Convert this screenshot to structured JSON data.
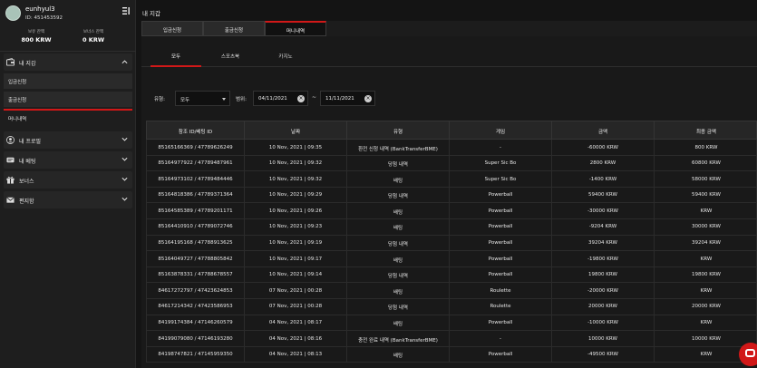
{
  "user": {
    "name": "eunhyul3",
    "id_label": "ID: 451453592"
  },
  "balances": {
    "held_label": "보유 잔액",
    "held_value": "800 KRW",
    "bonus_label": "보너스 잔액",
    "bonus_value": "0 KRW"
  },
  "sidebar": {
    "wallet": "내 지갑",
    "deposit": "입금신청",
    "withdraw": "출금신청",
    "history": "머니내역",
    "profile": "내 프로필",
    "betting": "내 베팅",
    "bonus": "보너스",
    "messages": "편지함"
  },
  "page": {
    "title": "내 지갑"
  },
  "top_tabs": {
    "deposit": "입금신청",
    "withdraw": "출금신청",
    "history": "머니내역"
  },
  "sub_tabs": {
    "all": "모두",
    "sports": "스포츠북",
    "casino": "카지노"
  },
  "filters": {
    "type_label": "유형:",
    "type_value": "모두",
    "range_label": "범위:",
    "date_from": "04/11/2021",
    "date_to": "11/11/2021",
    "separator": "~"
  },
  "table": {
    "headers": [
      "참조 ID/베팅 ID",
      "날짜",
      "유형",
      "게임",
      "금액",
      "최종 금액"
    ],
    "rows": [
      [
        "85165166369 / 47789626249",
        "10 Nov, 2021 | 09:35",
        "환전 신청 내역 (BankTransferBME)",
        "-",
        "-60000 KRW",
        "800 KRW"
      ],
      [
        "85164977922 / 47789487961",
        "10 Nov, 2021 | 09:32",
        "당첨 내역",
        "Super Sic Bo",
        "2800 KRW",
        "60800 KRW"
      ],
      [
        "85164973102 / 47789484446",
        "10 Nov, 2021 | 09:32",
        "배팅",
        "Super Sic Bo",
        "-1400 KRW",
        "58000 KRW"
      ],
      [
        "85164818386 / 47789371364",
        "10 Nov, 2021 | 09:29",
        "당첨 내역",
        "Powerball",
        "59400 KRW",
        "59400 KRW"
      ],
      [
        "85164585389 / 47789201171",
        "10 Nov, 2021 | 09:26",
        "배팅",
        "Powerball",
        "-30000 KRW",
        "KRW"
      ],
      [
        "85164410910 / 47789072746",
        "10 Nov, 2021 | 09:23",
        "배팅",
        "Powerball",
        "-9204 KRW",
        "30000 KRW"
      ],
      [
        "85164195168 / 47788913625",
        "10 Nov, 2021 | 09:19",
        "당첨 내역",
        "Powerball",
        "39204 KRW",
        "39204 KRW"
      ],
      [
        "85164049727 / 47788805842",
        "10 Nov, 2021 | 09:17",
        "배팅",
        "Powerball",
        "-19800 KRW",
        "KRW"
      ],
      [
        "85163878331 / 47788678557",
        "10 Nov, 2021 | 09:14",
        "당첨 내역",
        "Powerball",
        "19800 KRW",
        "19800 KRW"
      ],
      [
        "84617272797 / 47423624853",
        "07 Nov, 2021 | 00:28",
        "배팅",
        "Roulette",
        "-20000 KRW",
        "KRW"
      ],
      [
        "84617214342 / 47423586953",
        "07 Nov, 2021 | 00:28",
        "당첨 내역",
        "Roulette",
        "20000 KRW",
        "20000 KRW"
      ],
      [
        "84199174384 / 47146260579",
        "04 Nov, 2021 | 08:17",
        "배팅",
        "Powerball",
        "-10000 KRW",
        "KRW"
      ],
      [
        "84199079080 / 47146193280",
        "04 Nov, 2021 | 08:16",
        "충전 완료 내역 (BankTransferBME)",
        "-",
        "10000 KRW",
        "10000 KRW"
      ],
      [
        "84198747821 / 47145959350",
        "04 Nov, 2021 | 08:13",
        "배팅",
        "Powerball",
        "-49500 KRW",
        "KRW"
      ]
    ]
  },
  "colors": {
    "accent": "#d11818",
    "background": "#141414",
    "sidebar": "#1e1e1e"
  }
}
